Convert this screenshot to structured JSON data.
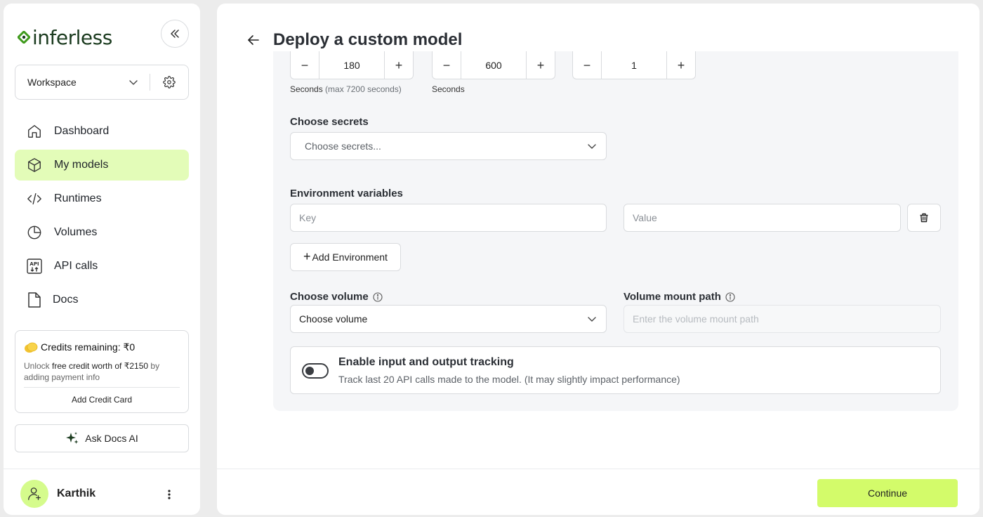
{
  "app": {
    "logo_text": "inferless",
    "brand_color": "#1b3b1f",
    "accent_color": "#d3fb6a"
  },
  "sidebar": {
    "workspace_label": "Workspace",
    "nav": [
      {
        "label": "Dashboard",
        "icon": "home-icon",
        "active": false
      },
      {
        "label": "My models",
        "icon": "cube-icon",
        "active": true
      },
      {
        "label": "Runtimes",
        "icon": "code-icon",
        "active": false
      },
      {
        "label": "Volumes",
        "icon": "pie-chart-icon",
        "active": false
      },
      {
        "label": "API calls",
        "icon": "api-icon",
        "active": false
      },
      {
        "label": "Docs",
        "icon": "document-icon",
        "active": false
      }
    ],
    "credits": {
      "title": "Credits remaining: ₹0",
      "desc_pre": "Unlock ",
      "desc_highlight": "free credit worth of ₹2150",
      "desc_post": " by adding payment info",
      "action": "Add Credit Card"
    },
    "ask_docs_label": "Ask Docs AI",
    "user": {
      "name": "Karthik"
    }
  },
  "main": {
    "title": "Deploy a custom model",
    "steppers": [
      {
        "value": "180",
        "hint": "Seconds",
        "hint_muted": "(max 7200 seconds)"
      },
      {
        "value": "600",
        "hint": "Seconds",
        "hint_muted": ""
      },
      {
        "value": "1",
        "hint": "",
        "hint_muted": ""
      }
    ],
    "secrets": {
      "label": "Choose secrets",
      "placeholder": "Choose secrets..."
    },
    "env": {
      "label": "Environment variables",
      "key_placeholder": "Key",
      "value_placeholder": "Value",
      "add_label": "Add Environment"
    },
    "volume": {
      "label": "Choose volume",
      "selected": "Choose volume"
    },
    "mount_path": {
      "label": "Volume mount path",
      "placeholder": "Enter the volume mount path"
    },
    "tracking": {
      "title": "Enable input and output tracking",
      "description": "Track last 20 API calls made to the model. (It may slightly impact performance)",
      "enabled": false
    },
    "continue_label": "Continue"
  }
}
